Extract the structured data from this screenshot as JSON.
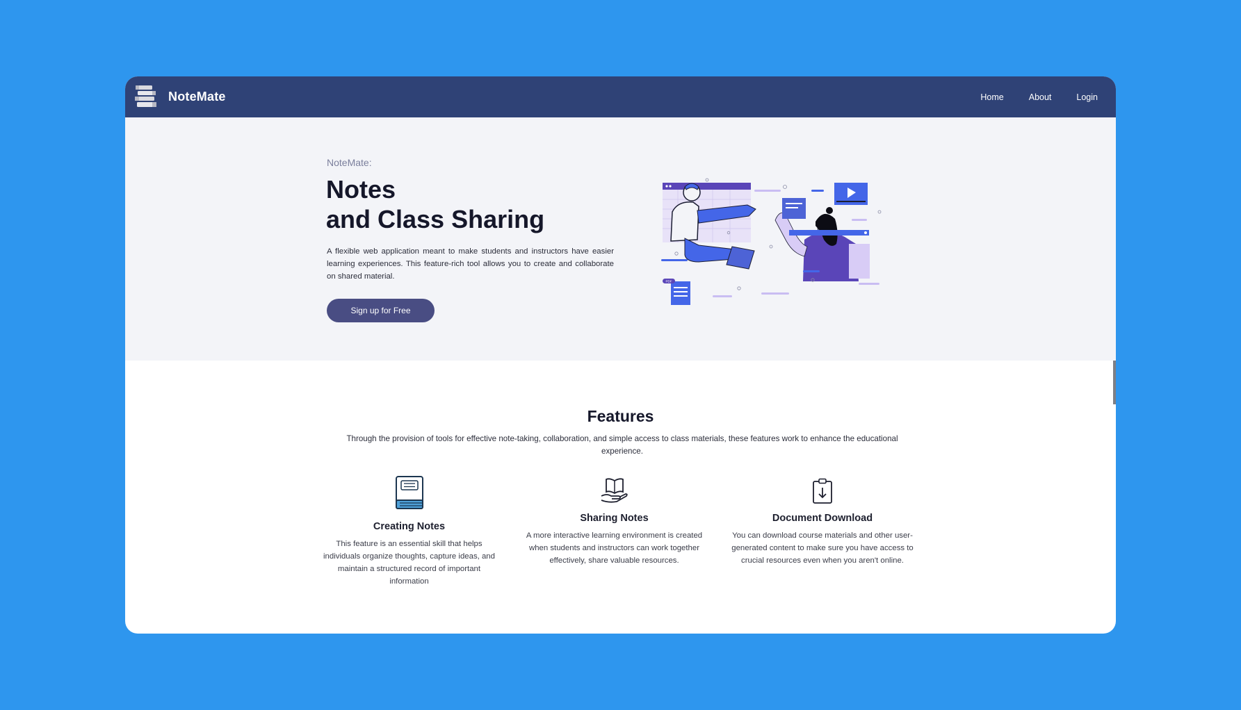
{
  "brand": {
    "name": "NoteMate",
    "logo_icon": "books-stack-icon"
  },
  "nav": {
    "items": [
      {
        "label": "Home"
      },
      {
        "label": "About"
      },
      {
        "label": "Login"
      }
    ]
  },
  "hero": {
    "eyebrow": "NoteMate:",
    "title_line1": "Notes",
    "title_line2": "and Class Sharing",
    "description": "A flexible web application meant to make students and instructors have easier learning experiences. This feature-rich tool allows you to create and collaborate on shared material.",
    "cta_label": "Sign up for Free",
    "illustration_icon": "collaboration-illustration",
    "illustration_badge": "PDF"
  },
  "features": {
    "title": "Features",
    "description": "Through the provision of tools for effective note-taking, collaboration, and simple access to class materials, these features work to enhance the educational experience.",
    "items": [
      {
        "icon": "notebook-icon",
        "title": "Creating Notes",
        "description": "This feature is an essential skill that helps individuals organize thoughts, capture ideas, and maintain a structured record of important information"
      },
      {
        "icon": "hand-book-icon",
        "title": "Sharing Notes",
        "description": "A more interactive learning environment is created when students and instructors can work together effectively, share valuable resources."
      },
      {
        "icon": "clipboard-download-icon",
        "title": "Document Download",
        "description": "You can download course materials and other user-generated content to make sure you have access to crucial resources even when you aren't online."
      }
    ]
  },
  "colors": {
    "background": "#2e96ee",
    "navbar": "#2f4276",
    "hero_bg": "#f3f4f8",
    "button": "#494d83",
    "illustration_accent": "#4466e8"
  }
}
